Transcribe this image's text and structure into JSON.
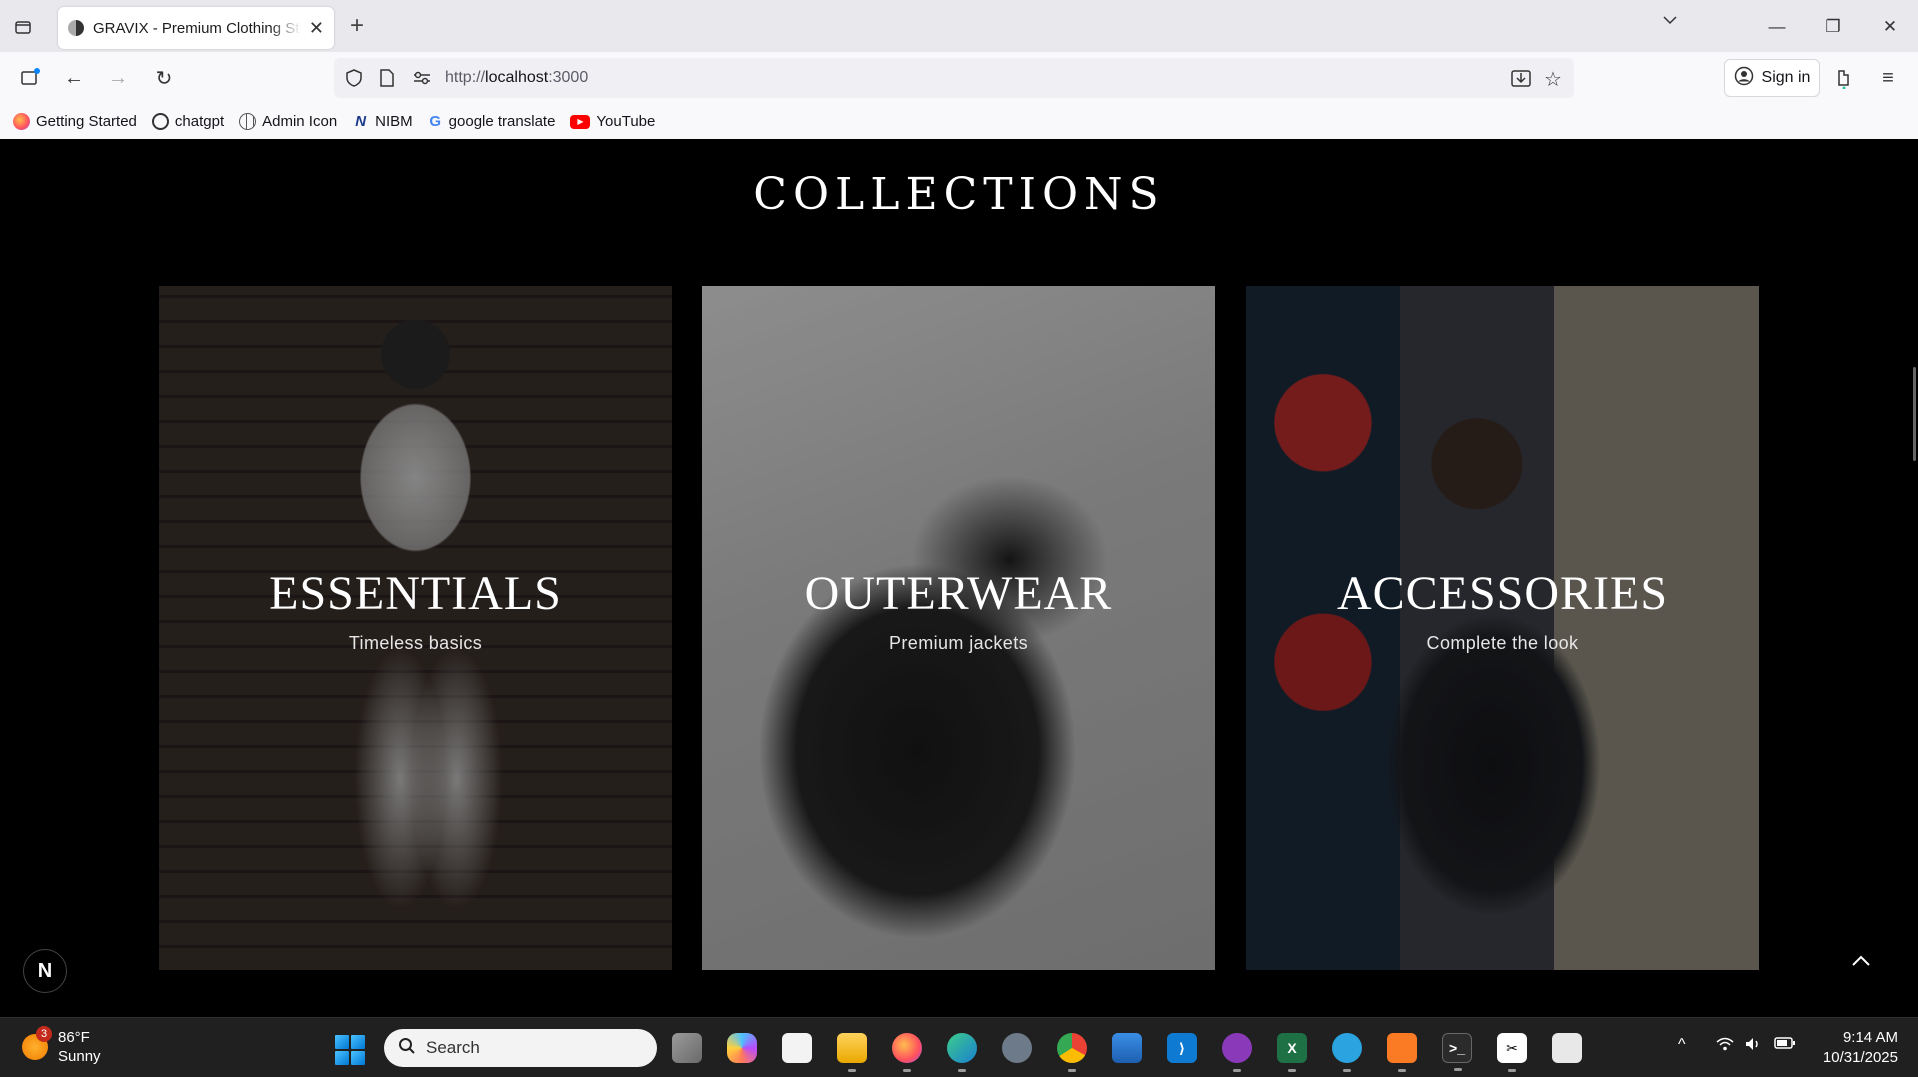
{
  "browser": {
    "tab_title": "GRAVIX - Premium Clothing Store",
    "url_prefix": "http://",
    "url_host": "localhost",
    "url_suffix": ":3000",
    "sign_in": "Sign in"
  },
  "bookmarks": [
    {
      "label": "Getting Started",
      "icon": "firefox-icon",
      "color": "#ff7139"
    },
    {
      "label": "chatgpt",
      "icon": "chatgpt-icon",
      "color": "#333333"
    },
    {
      "label": "Admin Icon",
      "icon": "globe-icon",
      "color": "#555555"
    },
    {
      "label": "NIBM",
      "icon": "nibm-icon",
      "color": "#1b3a8a"
    },
    {
      "label": "google translate",
      "icon": "google-icon",
      "color": "#4285f4"
    },
    {
      "label": "YouTube",
      "icon": "youtube-icon",
      "color": "#ff0000"
    }
  ],
  "page": {
    "heading": "COLLECTIONS",
    "collections": [
      {
        "title": "ESSENTIALS",
        "subtitle": "Timeless basics"
      },
      {
        "title": "OUTERWEAR",
        "subtitle": "Premium jackets"
      },
      {
        "title": "ACCESSORIES",
        "subtitle": "Complete the look"
      }
    ],
    "dev_badge": "N",
    "scroll_top_icon": "chevron-up-icon"
  },
  "taskbar": {
    "weather_temp": "86°F",
    "weather_desc": "Sunny",
    "weather_badge": "3",
    "search_placeholder": "Search",
    "time": "9:14 AM",
    "date": "10/31/2025"
  }
}
